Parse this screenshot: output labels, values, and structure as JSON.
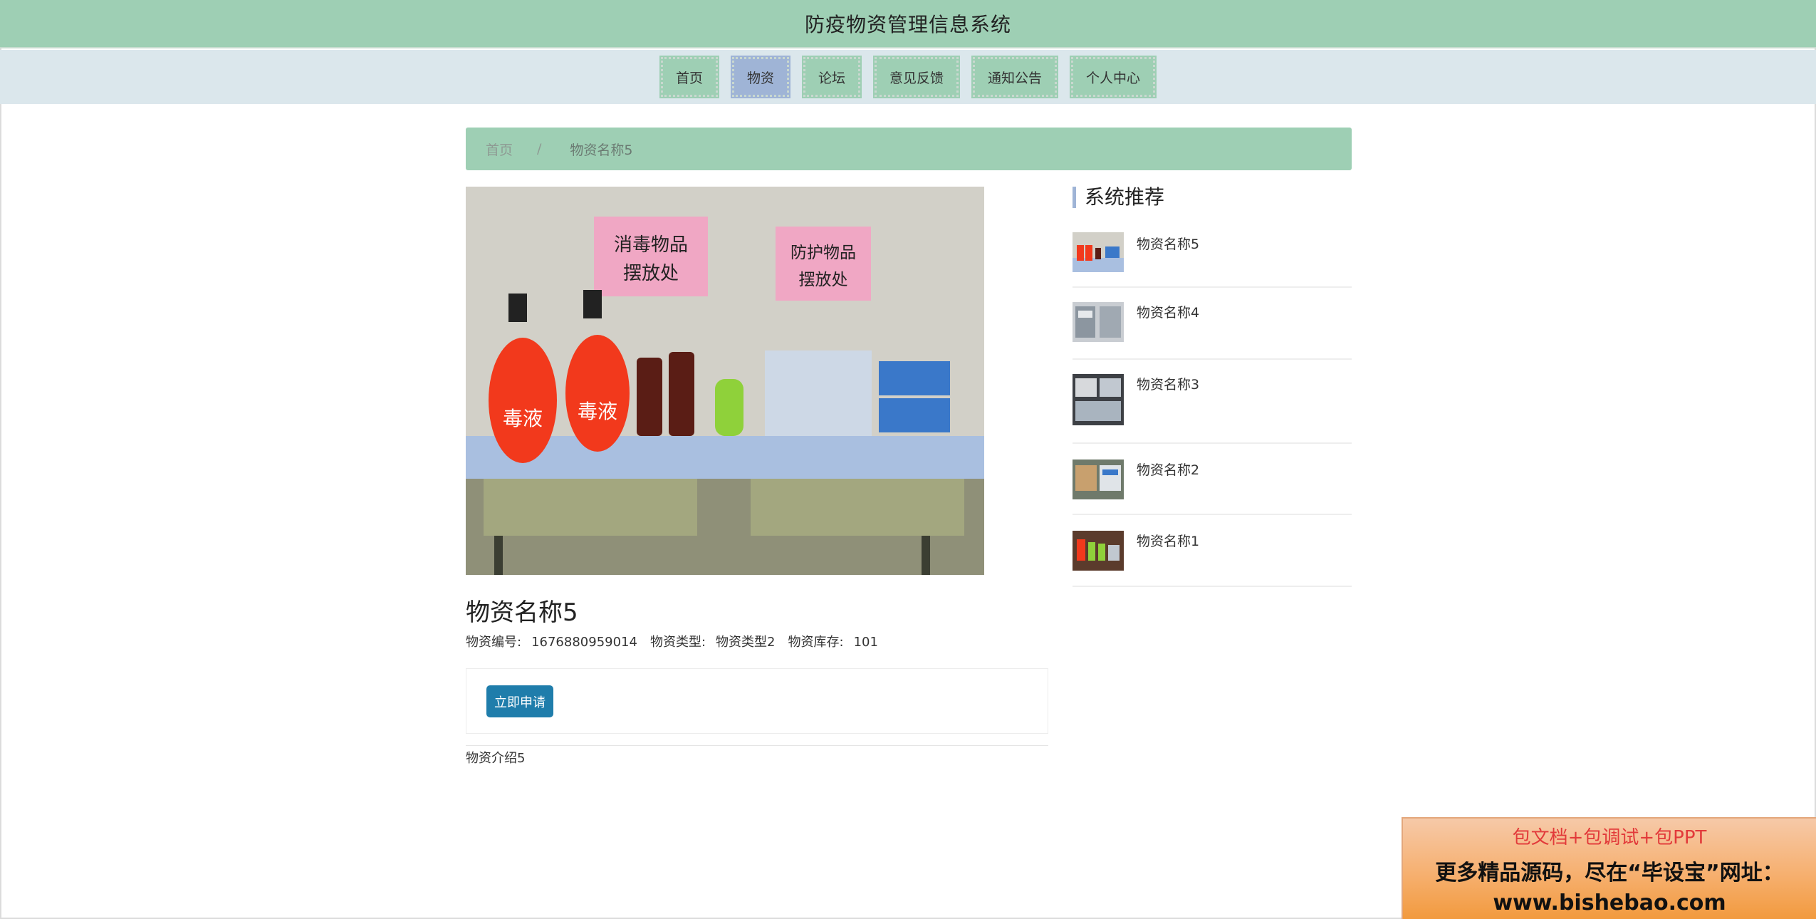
{
  "header": {
    "title": "防疫物资管理信息系统"
  },
  "nav": {
    "items": [
      {
        "label": "首页"
      },
      {
        "label": "物资"
      },
      {
        "label": "论坛"
      },
      {
        "label": "意见反馈"
      },
      {
        "label": "通知公告"
      },
      {
        "label": "个人中心"
      }
    ],
    "active": "物资"
  },
  "breadcrumb": {
    "home": "首页",
    "separator": "/",
    "current": "物资名称5"
  },
  "photo": {
    "sign_left_line1": "消毒物品",
    "sign_left_line2": "摆放处",
    "sign_right_line1": "防护物品",
    "sign_right_line2": "摆放处",
    "bottle_label": "毒液"
  },
  "detail": {
    "title": "物资名称5",
    "code_label": "物资编号:",
    "code_value": "1676880959014",
    "type_label": "物资类型:",
    "type_value": "物资类型2",
    "stock_label": "物资库存:",
    "stock_value": "101",
    "apply_button": "立即申请",
    "intro": "物资介绍5"
  },
  "sidebar": {
    "title": "系统推荐",
    "items": [
      {
        "name": "物资名称5"
      },
      {
        "name": "物资名称4"
      },
      {
        "name": "物资名称3"
      },
      {
        "name": "物资名称2"
      },
      {
        "name": "物资名称1"
      }
    ]
  },
  "promo": {
    "line1": "包文档+包调试+包PPT",
    "line2": "更多精品源码，尽在“毕设宝”网址：",
    "line3": "www.bishebao.com"
  },
  "colors": {
    "header_bg": "#9ecfb4",
    "nav_bg": "#dbe7ec",
    "nav_active": "#9fb4d6",
    "button": "#1f7dab"
  }
}
